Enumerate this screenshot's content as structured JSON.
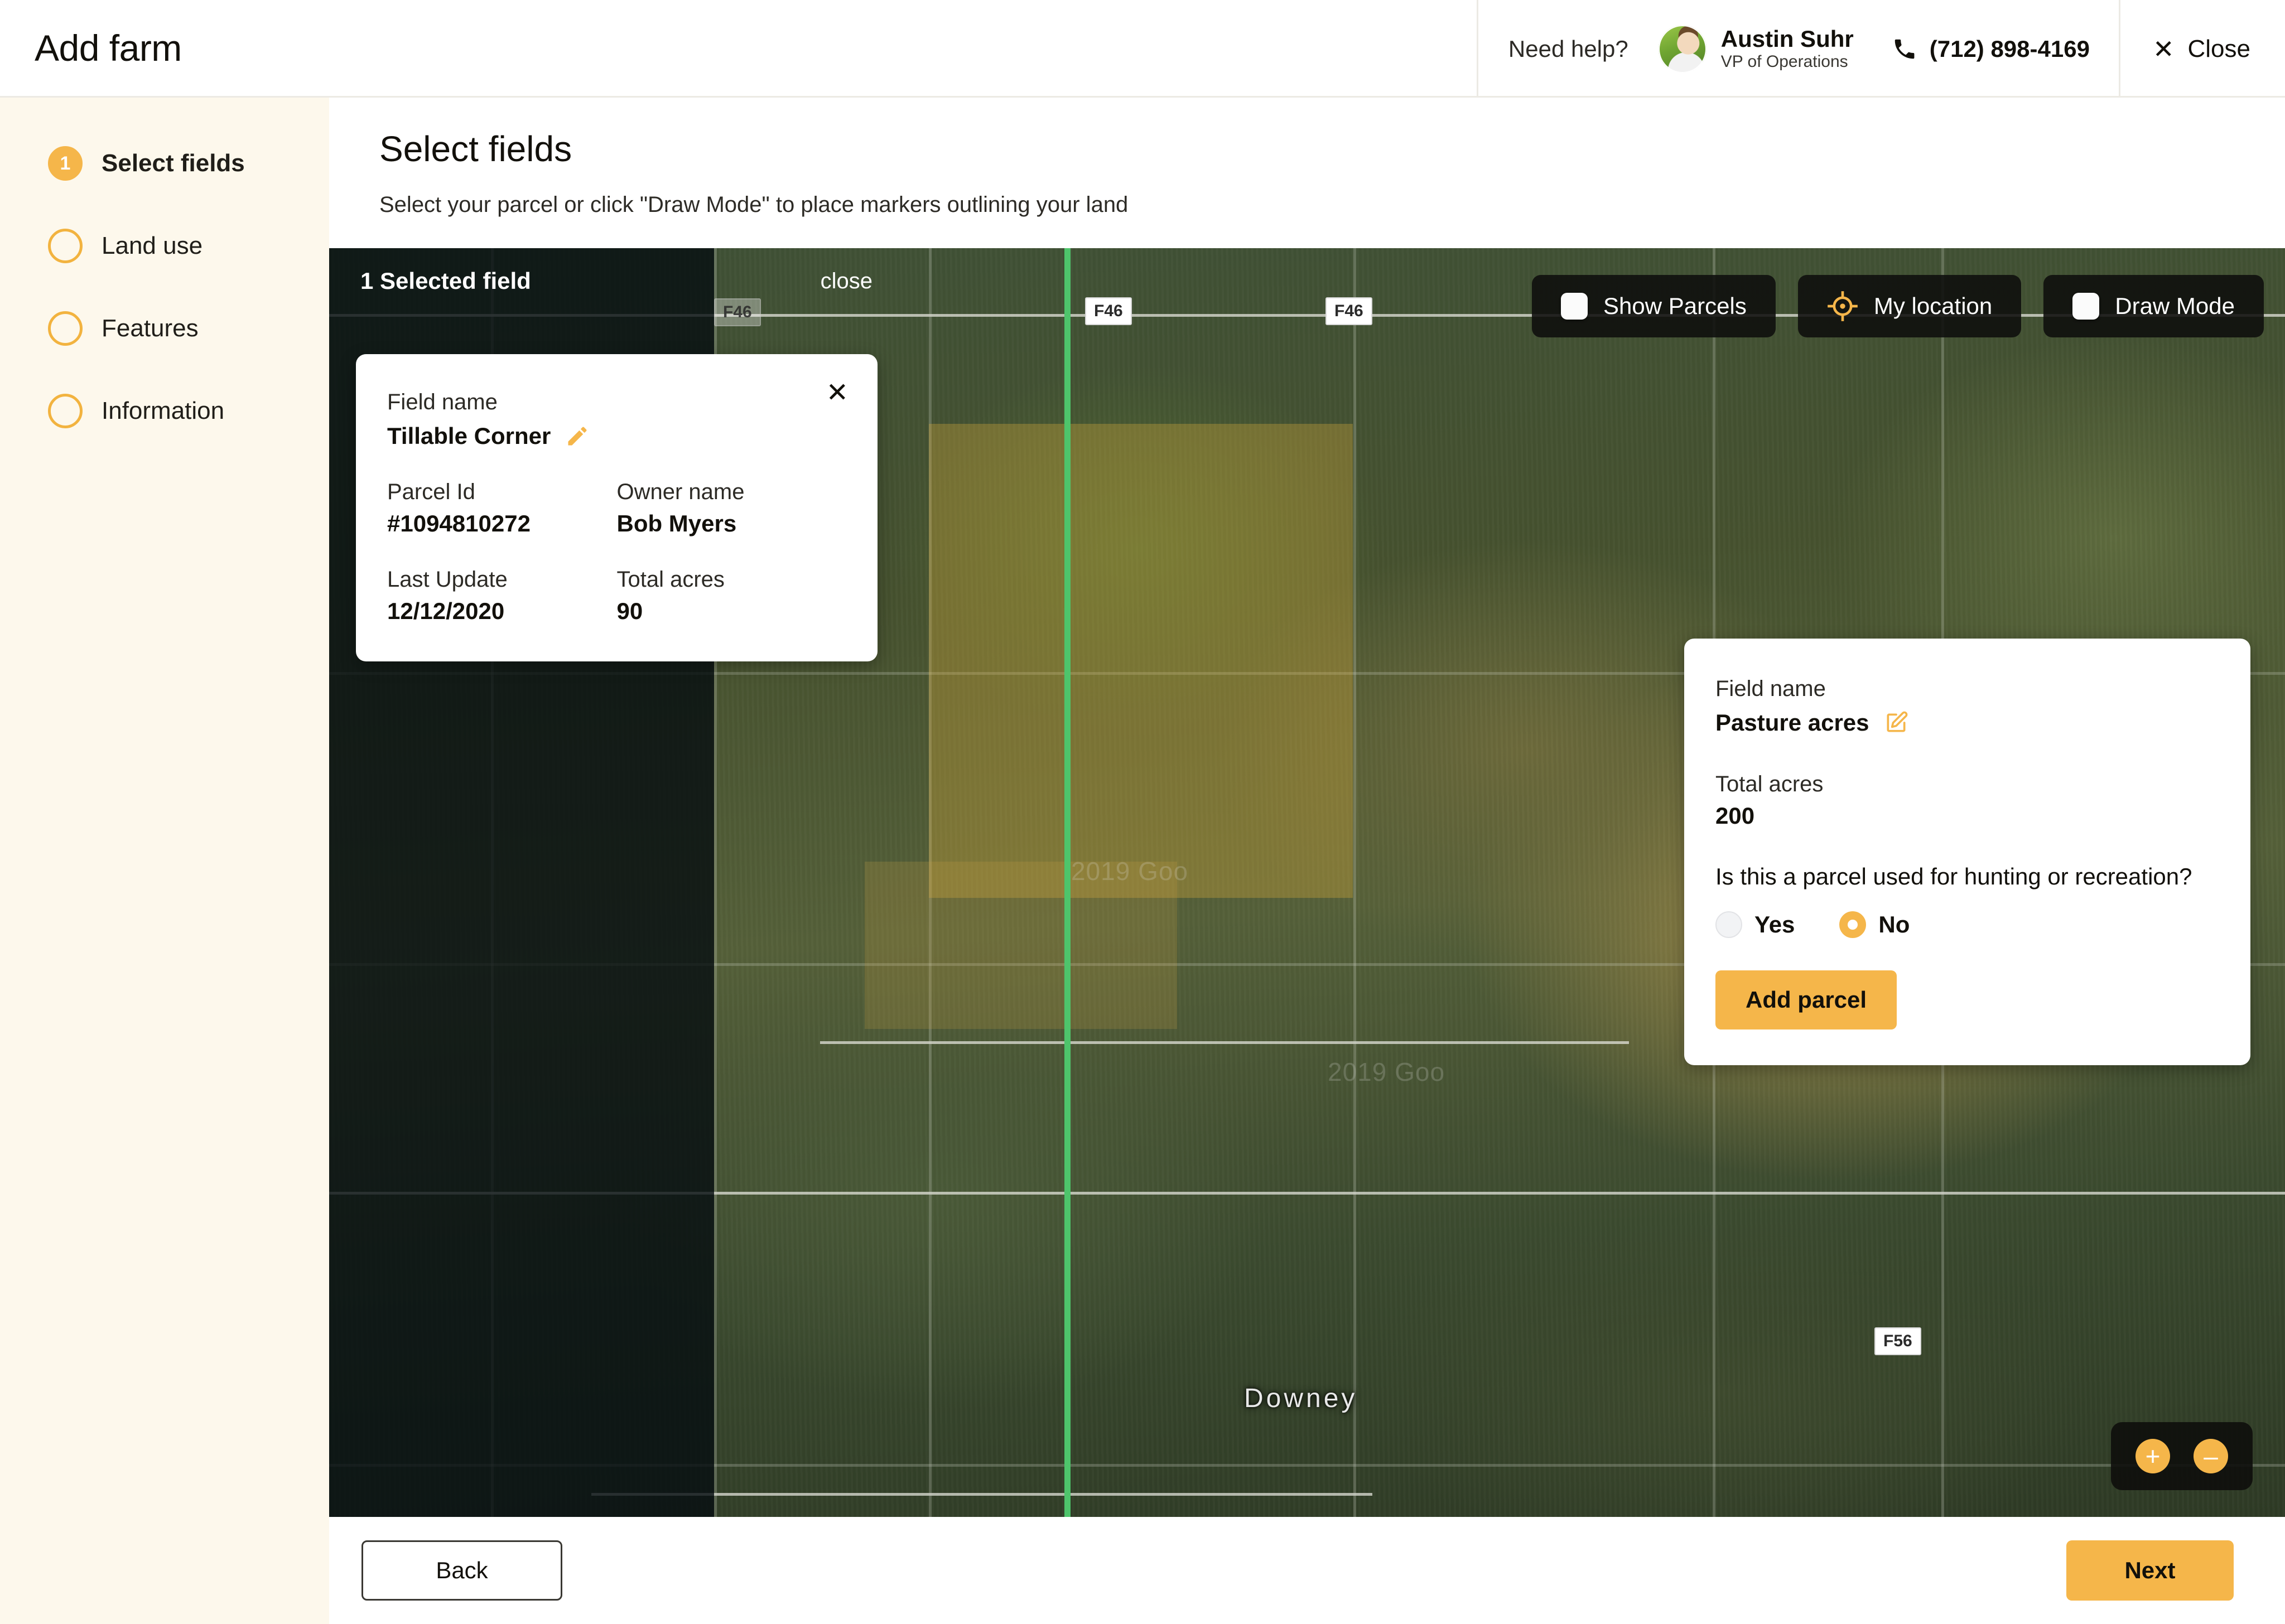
{
  "header": {
    "app_title": "Add farm",
    "need_help": "Need help?",
    "agent": {
      "name": "Austin Suhr",
      "role": "VP of Operations",
      "avatar_icon": "avatar"
    },
    "phone": {
      "icon": "phone-icon",
      "number": "(712) 898-4169"
    },
    "close": {
      "icon": "close-icon",
      "label": "Close"
    }
  },
  "sidebar": {
    "items": [
      {
        "num": "1",
        "label": "Select fields",
        "active": true
      },
      {
        "num": "",
        "label": "Land use",
        "active": false
      },
      {
        "num": "",
        "label": "Features",
        "active": false
      },
      {
        "num": "",
        "label": "Information",
        "active": false
      }
    ]
  },
  "main": {
    "title": "Select fields",
    "subtitle": "Select your parcel or click \"Draw Mode\" to place markers outlining your land"
  },
  "map": {
    "selected_strip": {
      "count_label": "1 Selected field",
      "close_label": "close"
    },
    "toolbar": [
      {
        "label": "Show Parcels",
        "control": "checkbox",
        "checked": false
      },
      {
        "label": "My location",
        "control": "crosshair-icon"
      },
      {
        "label": "Draw Mode",
        "control": "checkbox",
        "checked": false
      }
    ],
    "zoom": {
      "in_label": "+",
      "out_label": "–"
    },
    "road_badges": [
      "F46",
      "F46",
      "F46",
      "F56"
    ],
    "place_labels": [
      "Downey"
    ],
    "watermarks": [
      "2019 Goo",
      "2019 Goo"
    ],
    "accent_color": "#f5b64a",
    "selected_boundary_color": "#4ec46b"
  },
  "card_left": {
    "close_icon": "close-icon",
    "field_name_label": "Field name",
    "field_name_value": "Tillable Corner",
    "edit_icon": "pencil-icon",
    "parcel_id_label": "Parcel Id",
    "parcel_id_value": "#1094810272",
    "owner_label": "Owner name",
    "owner_value": "Bob Myers",
    "last_update_label": "Last Update",
    "last_update_value": "12/12/2020",
    "total_acres_label": "Total acres",
    "total_acres_value": "90"
  },
  "card_right": {
    "field_name_label": "Field name",
    "field_name_value": "Pasture acres",
    "edit_icon": "edit-square-icon",
    "total_acres_label": "Total acres",
    "total_acres_value": "200",
    "question": "Is this a parcel used for hunting or recreation?",
    "option_yes": "Yes",
    "option_no": "No",
    "selected_option": "No",
    "add_button": "Add parcel"
  },
  "footer": {
    "back_label": "Back",
    "next_label": "Next"
  }
}
